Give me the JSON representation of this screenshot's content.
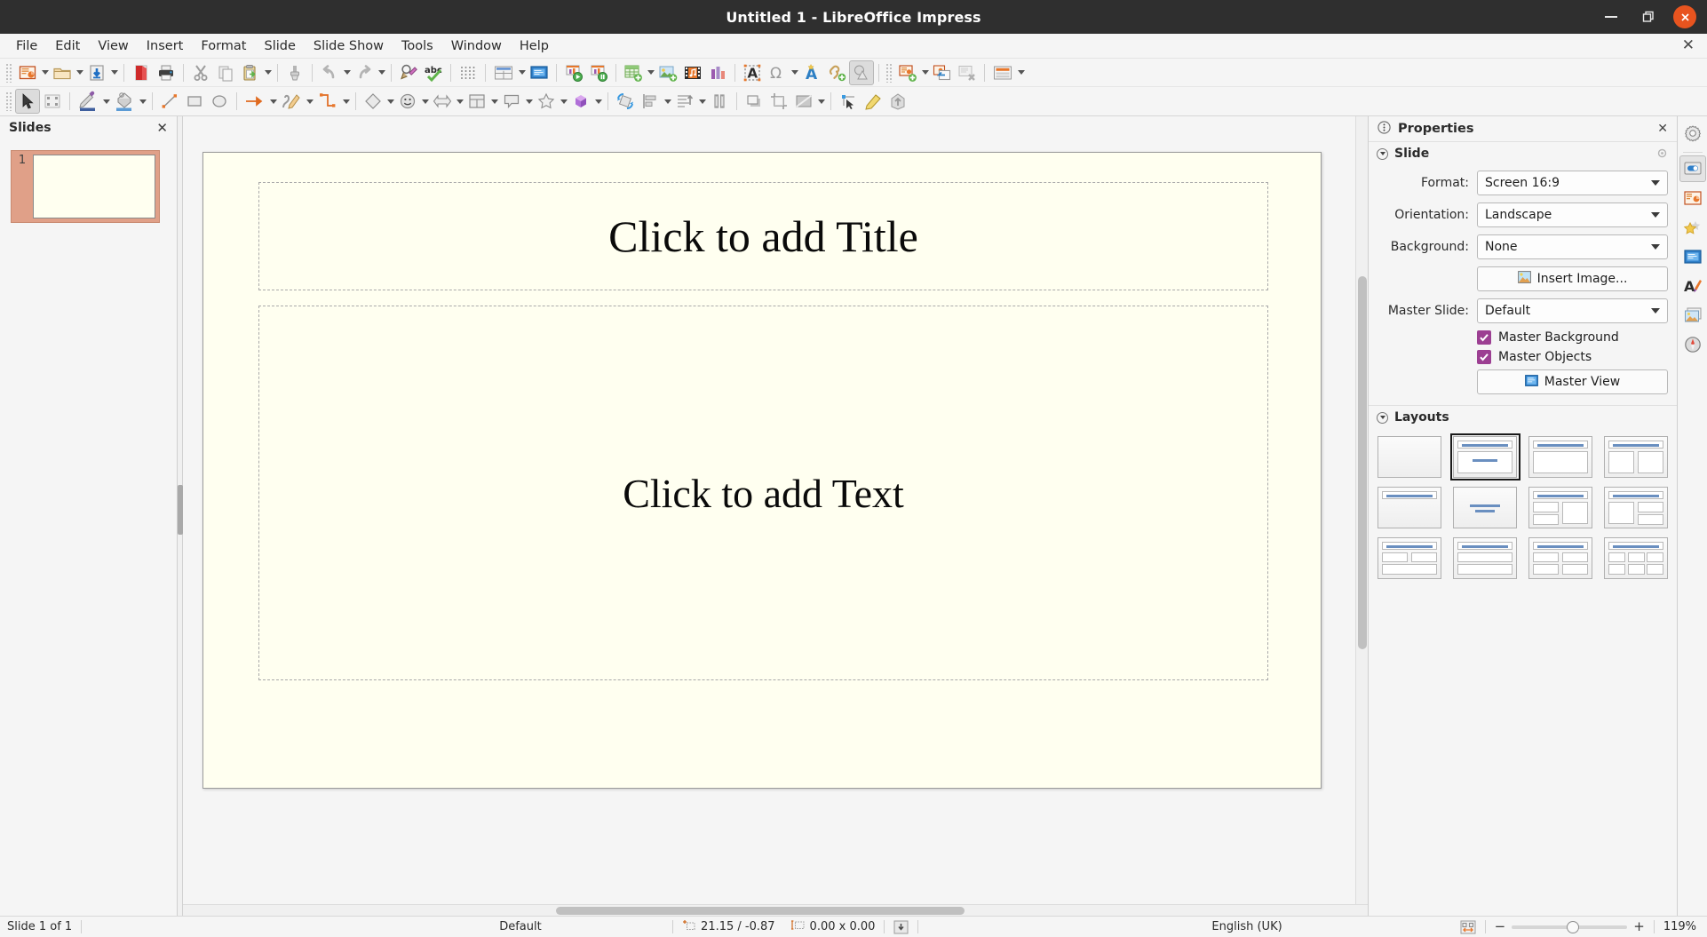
{
  "window": {
    "title": "Untitled 1 - LibreOffice Impress",
    "minimize_label": "Minimize",
    "maximize_label": "Restore",
    "close_label": "Close"
  },
  "menubar": {
    "items": [
      {
        "label": "File"
      },
      {
        "label": "Edit"
      },
      {
        "label": "View"
      },
      {
        "label": "Insert"
      },
      {
        "label": "Format"
      },
      {
        "label": "Slide"
      },
      {
        "label": "Slide Show"
      },
      {
        "label": "Tools"
      },
      {
        "label": "Window"
      },
      {
        "label": "Help"
      }
    ],
    "close_document": "✕"
  },
  "standard_toolbar": {
    "items": [
      {
        "name": "new-presentation",
        "icon": "new-doc-icon"
      },
      {
        "name": "open",
        "icon": "folder-open-icon"
      },
      {
        "name": "save",
        "icon": "save-download-icon"
      },
      {
        "name": "export-pdf",
        "icon": "pdf-icon"
      },
      {
        "name": "print",
        "icon": "printer-icon"
      },
      {
        "name": "cut",
        "icon": "scissors-icon"
      },
      {
        "name": "copy",
        "icon": "copy-icon"
      },
      {
        "name": "paste",
        "icon": "clipboard-paste-icon"
      },
      {
        "name": "clone-formatting",
        "icon": "paintbrush-icon"
      },
      {
        "name": "undo",
        "icon": "undo-arrow-icon"
      },
      {
        "name": "redo",
        "icon": "redo-arrow-icon"
      },
      {
        "name": "find-and-replace",
        "icon": "magnifier-pencil-icon"
      },
      {
        "name": "spelling",
        "icon": "abc-check-icon"
      },
      {
        "name": "display-grid",
        "icon": "grid-dots-icon"
      },
      {
        "name": "display-views",
        "icon": "display-views-icon"
      },
      {
        "name": "start-from-first-slide",
        "icon": "presentation-screen-icon"
      },
      {
        "name": "start-from-current-slide",
        "icon": "play-presentation-icon"
      },
      {
        "name": "presenter-console",
        "icon": "pause-presentation-icon"
      },
      {
        "name": "insert-table",
        "icon": "table-icon"
      },
      {
        "name": "insert-image",
        "icon": "image-icon"
      },
      {
        "name": "insert-audio-video",
        "icon": "media-icon"
      },
      {
        "name": "insert-chart",
        "icon": "chart-icon"
      },
      {
        "name": "insert-text-box",
        "icon": "text-box-icon"
      },
      {
        "name": "insert-special-character",
        "icon": "omega-icon"
      },
      {
        "name": "insert-fontwork",
        "icon": "fontwork-icon"
      },
      {
        "name": "insert-hyperlink",
        "icon": "hyperlink-icon"
      },
      {
        "name": "show-draw-functions",
        "icon": "draw-functions-icon"
      },
      {
        "name": "new-slide",
        "icon": "new-slide-icon"
      },
      {
        "name": "duplicate-slide",
        "icon": "duplicate-slide-icon"
      },
      {
        "name": "delete-slide",
        "icon": "delete-slide-icon"
      },
      {
        "name": "slide-layout",
        "icon": "slide-layout-icon"
      }
    ]
  },
  "drawing_toolbar": {
    "items": [
      {
        "name": "select",
        "icon": "cursor-arrow-icon"
      },
      {
        "name": "edit-points",
        "icon": "edit-points-icon"
      },
      {
        "name": "line-color",
        "icon": "pencil-line-color-icon"
      },
      {
        "name": "fill-color",
        "icon": "paint-can-fill-icon"
      },
      {
        "name": "insert-line",
        "icon": "line-icon"
      },
      {
        "name": "rectangle",
        "icon": "rectangle-icon"
      },
      {
        "name": "ellipse",
        "icon": "ellipse-icon"
      },
      {
        "name": "lines-and-arrows",
        "icon": "arrow-icon"
      },
      {
        "name": "curves-and-polygons",
        "icon": "curve-pencil-icon"
      },
      {
        "name": "connectors",
        "icon": "connector-icon"
      },
      {
        "name": "basic-shapes",
        "icon": "diamond-shape-icon"
      },
      {
        "name": "symbol-shapes",
        "icon": "smiley-icon"
      },
      {
        "name": "block-arrows",
        "icon": "block-arrow-icon"
      },
      {
        "name": "flowchart",
        "icon": "flowchart-icon"
      },
      {
        "name": "callouts",
        "icon": "callout-icon"
      },
      {
        "name": "stars",
        "icon": "star-icon"
      },
      {
        "name": "3d-objects",
        "icon": "cube-3d-icon"
      },
      {
        "name": "rotate",
        "icon": "rotate-icon"
      },
      {
        "name": "align-objects",
        "icon": "align-objects-icon"
      },
      {
        "name": "arrange",
        "icon": "arrange-icon"
      },
      {
        "name": "distribute-selection",
        "icon": "distribute-icon"
      },
      {
        "name": "shadow",
        "icon": "shadow-icon"
      },
      {
        "name": "crop-image",
        "icon": "crop-icon"
      },
      {
        "name": "filter",
        "icon": "filter-icon"
      },
      {
        "name": "points",
        "icon": "select-at-least-three-icon"
      },
      {
        "name": "glue-points",
        "icon": "glue-points-icon"
      },
      {
        "name": "toggle-extrusion",
        "icon": "extrusion-icon"
      }
    ]
  },
  "slides_panel": {
    "title": "Slides",
    "close": "✕",
    "slides": [
      {
        "number": "1"
      }
    ]
  },
  "slide_canvas": {
    "title_placeholder": "Click to add Title",
    "text_placeholder": "Click to add Text"
  },
  "sidebar": {
    "title": "Properties",
    "close": "✕",
    "slide_panel": {
      "heading": "Slide",
      "format_label": "Format:",
      "format_value": "Screen 16:9",
      "orientation_label": "Orientation:",
      "orientation_value": "Landscape",
      "background_label": "Background:",
      "background_value": "None",
      "insert_image_label": "Insert Image...",
      "master_slide_label": "Master Slide:",
      "master_slide_value": "Default",
      "master_background_label": "Master Background",
      "master_background_checked": true,
      "master_objects_label": "Master Objects",
      "master_objects_checked": true,
      "master_view_label": "Master View"
    },
    "layouts_panel": {
      "heading": "Layouts",
      "selected_index": 1,
      "items": [
        {
          "name": "blank-slide"
        },
        {
          "name": "title-content"
        },
        {
          "name": "title-only-content"
        },
        {
          "name": "title-two-content"
        },
        {
          "name": "title-only"
        },
        {
          "name": "centered-text"
        },
        {
          "name": "title-two-content-and-content"
        },
        {
          "name": "title-content-and-two-content"
        },
        {
          "name": "title-two-content-over-content"
        },
        {
          "name": "title-content-over-content"
        },
        {
          "name": "title-four-content"
        },
        {
          "name": "title-six-content"
        }
      ]
    },
    "rail": [
      {
        "name": "sidebar-settings",
        "icon": "gear-icon"
      },
      {
        "name": "sidebar-properties",
        "icon": "properties-toggle-icon",
        "selected": true
      },
      {
        "name": "sidebar-slide-transition",
        "icon": "slide-transition-icon"
      },
      {
        "name": "sidebar-animation",
        "icon": "animation-star-icon"
      },
      {
        "name": "sidebar-master-slides",
        "icon": "master-slides-icon"
      },
      {
        "name": "sidebar-styles",
        "icon": "styles-a-brush-icon"
      },
      {
        "name": "sidebar-gallery",
        "icon": "gallery-image-icon"
      },
      {
        "name": "sidebar-navigator",
        "icon": "navigator-compass-icon"
      }
    ]
  },
  "statusbar": {
    "slide_count": "Slide 1 of 1",
    "master": "Default",
    "cursor_position": "21.15 / -0.87",
    "object_size": "0.00 x 0.00",
    "language": "English (UK)",
    "zoom_percent": "119%",
    "zoom_minus": "−",
    "zoom_plus": "+"
  },
  "colors": {
    "titlebar_bg": "#2f2f2f",
    "chrome_bg": "#f5f5f5",
    "slide_bg": "#fffff0",
    "checkbox_accent": "#9c3f92",
    "close_button": "#e8541f",
    "thumb_selection": "#e0a088",
    "layout_accent": "#6a8fc0"
  }
}
